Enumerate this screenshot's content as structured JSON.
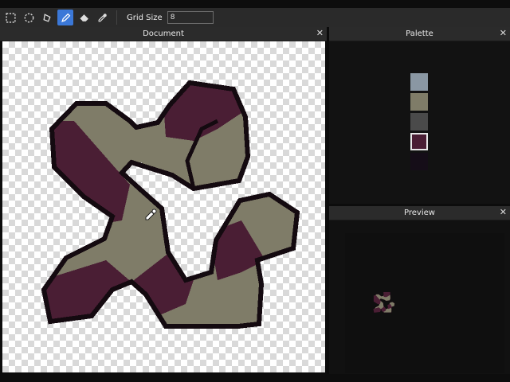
{
  "toolbar": {
    "tools": [
      {
        "name": "rect-select-icon"
      },
      {
        "name": "ellipse-select-icon"
      },
      {
        "name": "lasso-icon"
      },
      {
        "name": "pencil-icon",
        "active": true
      },
      {
        "name": "eraser-icon"
      },
      {
        "name": "eyedropper-icon"
      }
    ],
    "grid_size_label": "Grid Size",
    "grid_size_value": "8"
  },
  "panels": {
    "document": {
      "title": "Document",
      "close": "✕"
    },
    "palette": {
      "title": "Palette",
      "close": "✕"
    },
    "preview": {
      "title": "Preview",
      "close": "✕"
    }
  },
  "palette": {
    "colors": [
      "#8a97a3",
      "#7f7c68",
      "#4a4a4a",
      "#4a1e34",
      "#150d18"
    ],
    "selected_index": 3
  },
  "colors": {
    "outline": "#140a10",
    "khaki": "#7f7c68",
    "maroon": "#4a1e34",
    "accent": "#3b78d8"
  }
}
